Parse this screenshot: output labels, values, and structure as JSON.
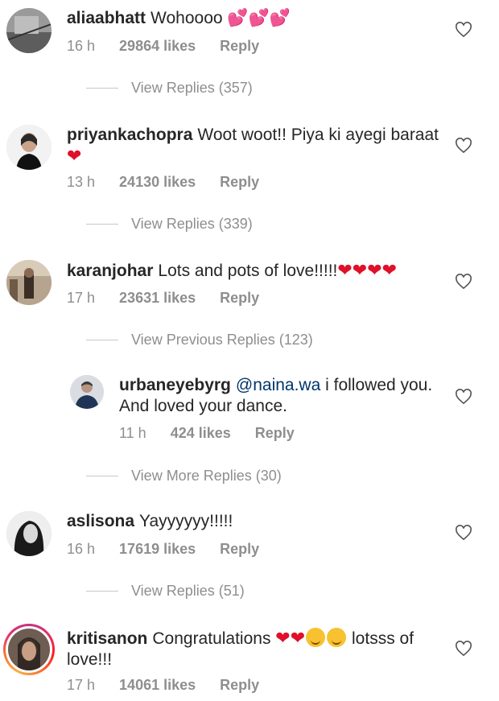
{
  "comments": [
    {
      "username": "aliaabhatt",
      "text": "Wohoooo",
      "emoji": "💕💕💕",
      "time": "16 h",
      "likes": "29864 likes",
      "reply_label": "Reply",
      "view_replies": "View Replies (357)"
    },
    {
      "username": "priyankachopra",
      "text": "Woot woot!! Piya ki ayegi baraat",
      "emoji": "❤",
      "time": "13 h",
      "likes": "24130 likes",
      "reply_label": "Reply",
      "view_replies": "View Replies (339)"
    },
    {
      "username": "karanjohar",
      "text": "Lots and pots of love!!!!!",
      "emoji": "❤❤❤❤",
      "time": "17 h",
      "likes": "23631 likes",
      "reply_label": "Reply",
      "view_replies": "View Previous Replies (123)"
    },
    {
      "username": "urbaneyebyrg",
      "mention": "@naina.wa",
      "text": "i followed you. And loved your dance.",
      "time": "11 h",
      "likes": "424 likes",
      "reply_label": "Reply",
      "view_replies": "View More Replies (30)"
    },
    {
      "username": "aslisona",
      "text": "Yayyyyyy!!!!!",
      "time": "16 h",
      "likes": "17619 likes",
      "reply_label": "Reply",
      "view_replies": "View Replies (51)"
    },
    {
      "username": "kritisanon",
      "text": "Congratulations",
      "emoji": "❤❤",
      "text_after": "lotsss of love!!!",
      "time": "17 h",
      "likes": "14061 likes",
      "reply_label": "Reply"
    }
  ],
  "icons": {
    "like": "heart-outline-icon"
  },
  "colors": {
    "heart_red": "#e0102a",
    "meta_gray": "#8e8e8e",
    "mention_blue": "#003569"
  }
}
